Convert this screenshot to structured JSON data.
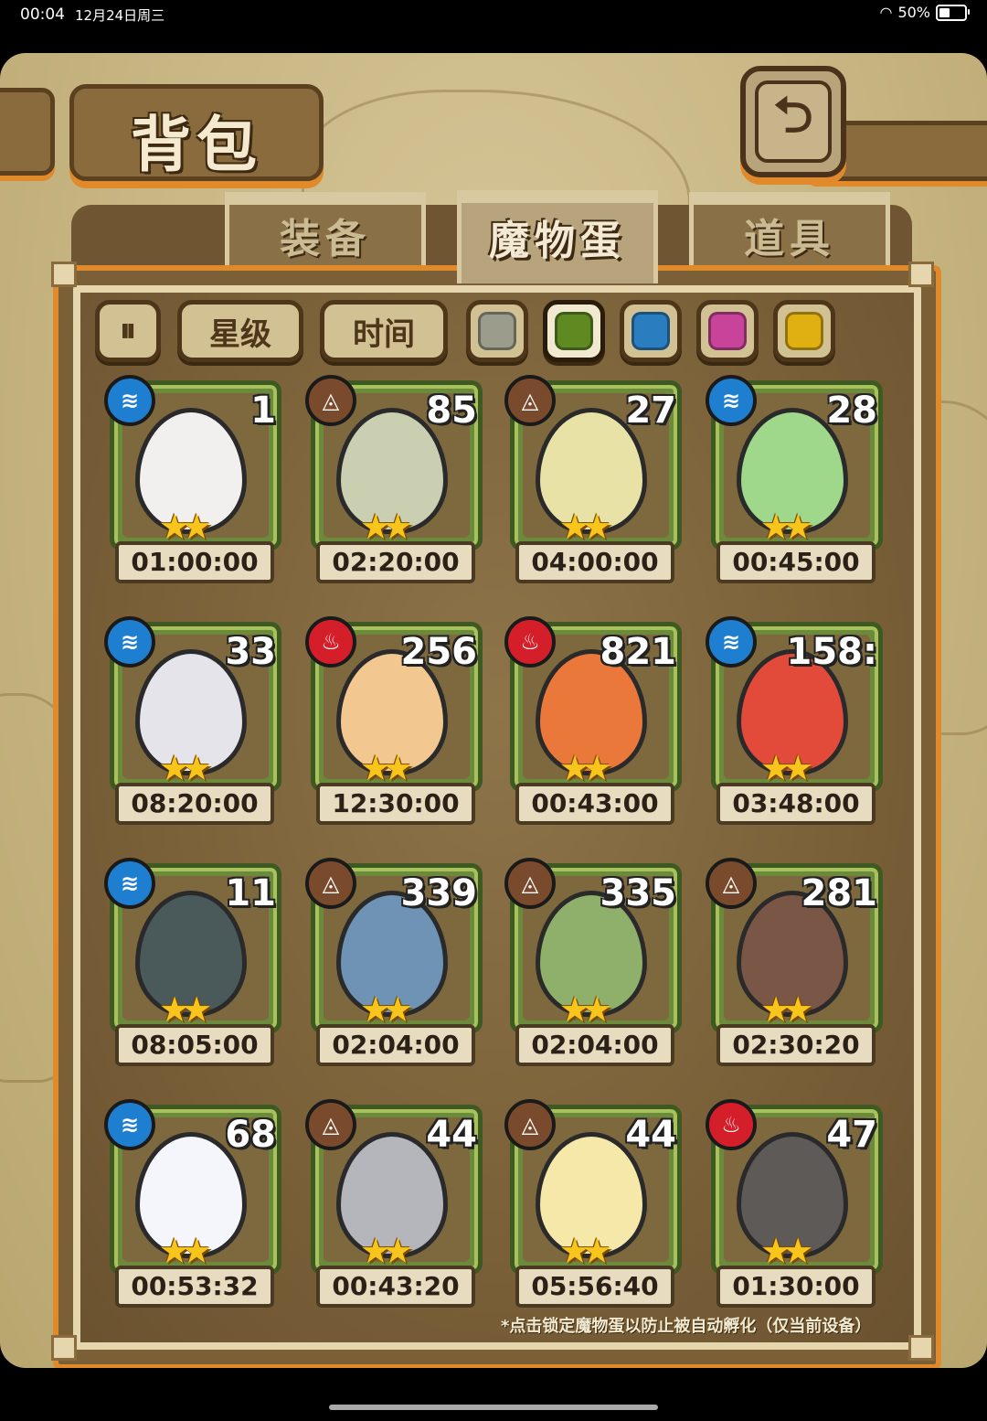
{
  "status_bar": {
    "time": "00:04",
    "date": "12月24日周三",
    "battery": "50%"
  },
  "title": "背包",
  "tabs": [
    {
      "label": "装备",
      "active": false
    },
    {
      "label": "魔物蛋",
      "active": true
    },
    {
      "label": "道具",
      "active": false
    }
  ],
  "filters": {
    "sort_icon": "sort-toggle-icon",
    "star_label": "星级",
    "time_label": "时间",
    "colors": [
      {
        "name": "gray",
        "hex": "#9c9c8c",
        "selected": false
      },
      {
        "name": "green",
        "hex": "#5f8a22",
        "selected": true
      },
      {
        "name": "blue",
        "hex": "#2a7ec0",
        "selected": false
      },
      {
        "name": "pink",
        "hex": "#c8449a",
        "selected": false
      },
      {
        "name": "yellow",
        "hex": "#e0b012",
        "selected": false
      }
    ]
  },
  "eggs": [
    {
      "count": "1",
      "element": "water",
      "timer": "01:00:00",
      "color": "#f2f0ee"
    },
    {
      "count": "85",
      "element": "earth",
      "timer": "02:20:00",
      "color": "#c9cfb0"
    },
    {
      "count": "27",
      "element": "earth",
      "timer": "04:00:00",
      "color": "#e9e2a6"
    },
    {
      "count": "28",
      "element": "water",
      "timer": "00:45:00",
      "color": "#9fd88a"
    },
    {
      "count": "33",
      "element": "water",
      "timer": "08:20:00",
      "color": "#e4e4ea"
    },
    {
      "count": "256",
      "element": "fire",
      "timer": "12:30:00",
      "color": "#f2c890"
    },
    {
      "count": "821",
      "element": "fire",
      "timer": "00:43:00",
      "color": "#e9783a"
    },
    {
      "count": "158:",
      "element": "water",
      "timer": "03:48:00",
      "color": "#e24a3a"
    },
    {
      "count": "11",
      "element": "water",
      "timer": "08:05:00",
      "color": "#4a5a5a"
    },
    {
      "count": "339",
      "element": "earth",
      "timer": "02:04:00",
      "color": "#6f93b4"
    },
    {
      "count": "335",
      "element": "earth",
      "timer": "02:04:00",
      "color": "#8fb06a"
    },
    {
      "count": "281",
      "element": "earth",
      "timer": "02:30:20",
      "color": "#7a5646"
    },
    {
      "count": "68",
      "element": "water",
      "timer": "00:53:32",
      "color": "#f4f6fb"
    },
    {
      "count": "44",
      "element": "earth",
      "timer": "00:43:20",
      "color": "#b4b6bc"
    },
    {
      "count": "44",
      "element": "earth",
      "timer": "05:56:40",
      "color": "#f5e8a8"
    },
    {
      "count": "47",
      "element": "fire",
      "timer": "01:30:00",
      "color": "#5e5a58"
    }
  ],
  "note": "*点击锁定魔物蛋以防止被自动孵化（仅当前设备）"
}
